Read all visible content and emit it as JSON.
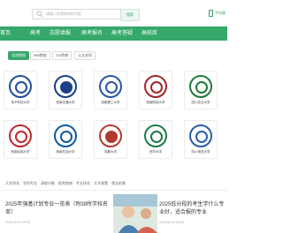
{
  "search": {
    "placeholder": "请输入你想查询的内容",
    "button_label": "搜索"
  },
  "topbar": {
    "right_label": "手机版"
  },
  "nav": {
    "items": [
      "首页",
      "高考",
      "志愿填报",
      "高考报名",
      "高考答疑",
      "高校库"
    ]
  },
  "filters": {
    "items": [
      "全部院校",
      "985院校",
      "211院校",
      "公立本科"
    ]
  },
  "schools": [
    {
      "name": "电子科技大学",
      "color": "#1f4f9c"
    },
    {
      "name": "西南交通大学",
      "color": "#1c3f8a"
    },
    {
      "name": "成都理工大学",
      "color": "#2656a8"
    },
    {
      "name": "西南财经大学",
      "color": "#a3262a"
    },
    {
      "name": "四川农业大学",
      "color": "#1f7a3a"
    },
    {
      "name": "西南民族大学",
      "color": "#c0282d"
    },
    {
      "name": "西南石油大学",
      "color": "#0f5a9c"
    },
    {
      "name": "成都大学",
      "color": "#b23a2f"
    },
    {
      "name": "西华大学",
      "color": "#1d7a4a"
    },
    {
      "name": "四川师范大学",
      "color": "#2a5ca8"
    }
  ],
  "tags": {
    "items": [
      "大学排名",
      "学科专业",
      "录取分数",
      "报考指南",
      "专业排名",
      "大学政策",
      "就业前景"
    ]
  },
  "articles": [
    {
      "title": "2025年强基计划专业一览表（附39所学校名单）",
      "date": "2025-05-20 09:30"
    },
    {
      "title": "2025低分段的考生学什么专业好，适合报的专业",
      "date": "2025-05-20 08:45"
    }
  ],
  "colors": {
    "brand": "#35a86a"
  }
}
